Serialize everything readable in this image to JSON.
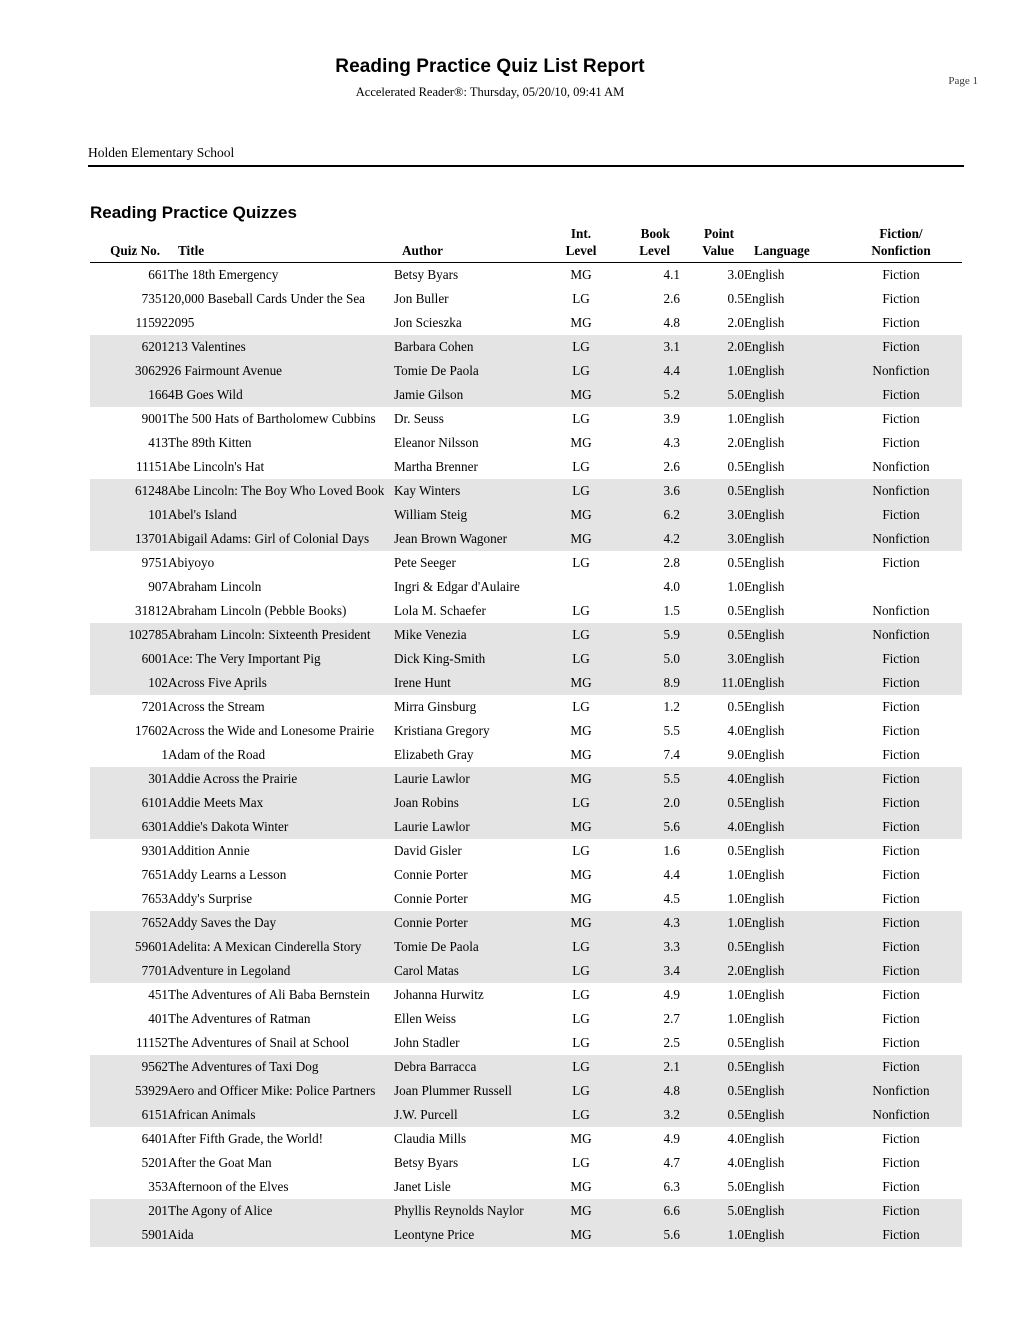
{
  "header": {
    "title": "Reading Practice Quiz List Report",
    "subtitle": "Accelerated Reader®:  Thursday, 05/20/10, 09:41 AM",
    "page_label": "Page 1"
  },
  "school": {
    "name": "Holden Elementary School"
  },
  "section": {
    "title": "Reading Practice Quizzes"
  },
  "columns": {
    "quiz_no": "Quiz No.",
    "title": "Title",
    "author": "Author",
    "int_level_l1": "Int.",
    "int_level_l2": "Level",
    "book_level_l1": "Book",
    "book_level_l2": "Level",
    "point_value_l1": "Point",
    "point_value_l2": "Value",
    "language": "Language",
    "fiction_l1": "Fiction/",
    "fiction_l2": "Nonfiction"
  },
  "rows": [
    {
      "quiz_no": "661",
      "title": "The 18th Emergency",
      "author": "Betsy Byars",
      "int_level": "MG",
      "book_level": "4.1",
      "point_value": "3.0",
      "language": "English",
      "fiction": "Fiction"
    },
    {
      "quiz_no": "7351",
      "title": "20,000 Baseball Cards Under the Sea",
      "author": "Jon Buller",
      "int_level": "LG",
      "book_level": "2.6",
      "point_value": "0.5",
      "language": "English",
      "fiction": "Fiction"
    },
    {
      "quiz_no": "11592",
      "title": "2095",
      "author": "Jon Scieszka",
      "int_level": "MG",
      "book_level": "4.8",
      "point_value": "2.0",
      "language": "English",
      "fiction": "Fiction"
    },
    {
      "quiz_no": "6201",
      "title": "213 Valentines",
      "author": "Barbara Cohen",
      "int_level": "LG",
      "book_level": "3.1",
      "point_value": "2.0",
      "language": "English",
      "fiction": "Fiction"
    },
    {
      "quiz_no": "30629",
      "title": "26 Fairmount Avenue",
      "author": "Tomie De Paola",
      "int_level": "LG",
      "book_level": "4.4",
      "point_value": "1.0",
      "language": "English",
      "fiction": "Nonfiction"
    },
    {
      "quiz_no": "166",
      "title": "4B Goes Wild",
      "author": "Jamie Gilson",
      "int_level": "MG",
      "book_level": "5.2",
      "point_value": "5.0",
      "language": "English",
      "fiction": "Fiction"
    },
    {
      "quiz_no": "9001",
      "title": "The 500 Hats of Bartholomew Cubbins",
      "author": "Dr. Seuss",
      "int_level": "LG",
      "book_level": "3.9",
      "point_value": "1.0",
      "language": "English",
      "fiction": "Fiction"
    },
    {
      "quiz_no": "413",
      "title": "The 89th Kitten",
      "author": "Eleanor Nilsson",
      "int_level": "MG",
      "book_level": "4.3",
      "point_value": "2.0",
      "language": "English",
      "fiction": "Fiction"
    },
    {
      "quiz_no": "11151",
      "title": "Abe Lincoln's Hat",
      "author": "Martha Brenner",
      "int_level": "LG",
      "book_level": "2.6",
      "point_value": "0.5",
      "language": "English",
      "fiction": "Nonfiction"
    },
    {
      "quiz_no": "61248",
      "title": "Abe Lincoln: The Boy Who Loved Books",
      "author": "Kay Winters",
      "int_level": "LG",
      "book_level": "3.6",
      "point_value": "0.5",
      "language": "English",
      "fiction": "Nonfiction"
    },
    {
      "quiz_no": "101",
      "title": "Abel's Island",
      "author": "William Steig",
      "int_level": "MG",
      "book_level": "6.2",
      "point_value": "3.0",
      "language": "English",
      "fiction": "Fiction"
    },
    {
      "quiz_no": "13701",
      "title": "Abigail Adams: Girl of Colonial Days",
      "author": "Jean Brown Wagoner",
      "int_level": "MG",
      "book_level": "4.2",
      "point_value": "3.0",
      "language": "English",
      "fiction": "Nonfiction"
    },
    {
      "quiz_no": "9751",
      "title": "Abiyoyo",
      "author": "Pete Seeger",
      "int_level": "LG",
      "book_level": "2.8",
      "point_value": "0.5",
      "language": "English",
      "fiction": "Fiction"
    },
    {
      "quiz_no": "907",
      "title": "Abraham Lincoln",
      "author": "Ingri & Edgar d'Aulaire",
      "int_level": "",
      "book_level": "4.0",
      "point_value": "1.0",
      "language": "English",
      "fiction": ""
    },
    {
      "quiz_no": "31812",
      "title": "Abraham Lincoln (Pebble Books)",
      "author": "Lola M. Schaefer",
      "int_level": "LG",
      "book_level": "1.5",
      "point_value": "0.5",
      "language": "English",
      "fiction": "Nonfiction"
    },
    {
      "quiz_no": "102785",
      "title": "Abraham Lincoln: Sixteenth President",
      "author": "Mike Venezia",
      "int_level": "LG",
      "book_level": "5.9",
      "point_value": "0.5",
      "language": "English",
      "fiction": "Nonfiction"
    },
    {
      "quiz_no": "6001",
      "title": "Ace: The Very Important Pig",
      "author": "Dick King-Smith",
      "int_level": "LG",
      "book_level": "5.0",
      "point_value": "3.0",
      "language": "English",
      "fiction": "Fiction"
    },
    {
      "quiz_no": "102",
      "title": "Across Five Aprils",
      "author": "Irene Hunt",
      "int_level": "MG",
      "book_level": "8.9",
      "point_value": "11.0",
      "language": "English",
      "fiction": "Fiction"
    },
    {
      "quiz_no": "7201",
      "title": "Across the Stream",
      "author": "Mirra Ginsburg",
      "int_level": "LG",
      "book_level": "1.2",
      "point_value": "0.5",
      "language": "English",
      "fiction": "Fiction"
    },
    {
      "quiz_no": "17602",
      "title": "Across the Wide and Lonesome Prairie",
      "author": "Kristiana Gregory",
      "int_level": "MG",
      "book_level": "5.5",
      "point_value": "4.0",
      "language": "English",
      "fiction": "Fiction"
    },
    {
      "quiz_no": "1",
      "title": "Adam of the Road",
      "author": "Elizabeth Gray",
      "int_level": "MG",
      "book_level": "7.4",
      "point_value": "9.0",
      "language": "English",
      "fiction": "Fiction"
    },
    {
      "quiz_no": "301",
      "title": "Addie Across the Prairie",
      "author": "Laurie Lawlor",
      "int_level": "MG",
      "book_level": "5.5",
      "point_value": "4.0",
      "language": "English",
      "fiction": "Fiction"
    },
    {
      "quiz_no": "6101",
      "title": "Addie Meets Max",
      "author": "Joan Robins",
      "int_level": "LG",
      "book_level": "2.0",
      "point_value": "0.5",
      "language": "English",
      "fiction": "Fiction"
    },
    {
      "quiz_no": "6301",
      "title": "Addie's Dakota Winter",
      "author": "Laurie Lawlor",
      "int_level": "MG",
      "book_level": "5.6",
      "point_value": "4.0",
      "language": "English",
      "fiction": "Fiction"
    },
    {
      "quiz_no": "9301",
      "title": "Addition Annie",
      "author": "David Gisler",
      "int_level": "LG",
      "book_level": "1.6",
      "point_value": "0.5",
      "language": "English",
      "fiction": "Fiction"
    },
    {
      "quiz_no": "7651",
      "title": "Addy Learns a Lesson",
      "author": "Connie Porter",
      "int_level": "MG",
      "book_level": "4.4",
      "point_value": "1.0",
      "language": "English",
      "fiction": "Fiction"
    },
    {
      "quiz_no": "7653",
      "title": "Addy's Surprise",
      "author": "Connie Porter",
      "int_level": "MG",
      "book_level": "4.5",
      "point_value": "1.0",
      "language": "English",
      "fiction": "Fiction"
    },
    {
      "quiz_no": "7652",
      "title": "Addy Saves the Day",
      "author": "Connie Porter",
      "int_level": "MG",
      "book_level": "4.3",
      "point_value": "1.0",
      "language": "English",
      "fiction": "Fiction"
    },
    {
      "quiz_no": "59601",
      "title": "Adelita: A Mexican Cinderella Story",
      "author": "Tomie De Paola",
      "int_level": "LG",
      "book_level": "3.3",
      "point_value": "0.5",
      "language": "English",
      "fiction": "Fiction"
    },
    {
      "quiz_no": "7701",
      "title": "Adventure in Legoland",
      "author": "Carol Matas",
      "int_level": "LG",
      "book_level": "3.4",
      "point_value": "2.0",
      "language": "English",
      "fiction": "Fiction"
    },
    {
      "quiz_no": "451",
      "title": "The Adventures of Ali Baba Bernstein",
      "author": "Johanna Hurwitz",
      "int_level": "LG",
      "book_level": "4.9",
      "point_value": "1.0",
      "language": "English",
      "fiction": "Fiction"
    },
    {
      "quiz_no": "401",
      "title": "The Adventures of Ratman",
      "author": "Ellen Weiss",
      "int_level": "LG",
      "book_level": "2.7",
      "point_value": "1.0",
      "language": "English",
      "fiction": "Fiction"
    },
    {
      "quiz_no": "11152",
      "title": "The Adventures of Snail at School",
      "author": "John Stadler",
      "int_level": "LG",
      "book_level": "2.5",
      "point_value": "0.5",
      "language": "English",
      "fiction": "Fiction"
    },
    {
      "quiz_no": "9562",
      "title": "The Adventures of Taxi Dog",
      "author": "Debra Barracca",
      "int_level": "LG",
      "book_level": "2.1",
      "point_value": "0.5",
      "language": "English",
      "fiction": "Fiction"
    },
    {
      "quiz_no": "53929",
      "title": "Aero and Officer Mike: Police Partners",
      "author": "Joan Plummer Russell",
      "int_level": "LG",
      "book_level": "4.8",
      "point_value": "0.5",
      "language": "English",
      "fiction": "Nonfiction"
    },
    {
      "quiz_no": "6151",
      "title": "African Animals",
      "author": "J.W. Purcell",
      "int_level": "LG",
      "book_level": "3.2",
      "point_value": "0.5",
      "language": "English",
      "fiction": "Nonfiction"
    },
    {
      "quiz_no": "6401",
      "title": "After Fifth Grade, the World!",
      "author": "Claudia Mills",
      "int_level": "MG",
      "book_level": "4.9",
      "point_value": "4.0",
      "language": "English",
      "fiction": "Fiction"
    },
    {
      "quiz_no": "5201",
      "title": "After the Goat Man",
      "author": "Betsy Byars",
      "int_level": "LG",
      "book_level": "4.7",
      "point_value": "4.0",
      "language": "English",
      "fiction": "Fiction"
    },
    {
      "quiz_no": "353",
      "title": "Afternoon of the Elves",
      "author": "Janet Lisle",
      "int_level": "MG",
      "book_level": "6.3",
      "point_value": "5.0",
      "language": "English",
      "fiction": "Fiction"
    },
    {
      "quiz_no": "201",
      "title": "The Agony of Alice",
      "author": "Phyllis Reynolds Naylor",
      "int_level": "MG",
      "book_level": "6.6",
      "point_value": "5.0",
      "language": "English",
      "fiction": "Fiction"
    },
    {
      "quiz_no": "5901",
      "title": "Aida",
      "author": "Leontyne Price",
      "int_level": "MG",
      "book_level": "5.6",
      "point_value": "1.0",
      "language": "English",
      "fiction": "Fiction"
    }
  ],
  "style": {
    "shade_color": "#e4e4e4",
    "text_color": "#000000"
  }
}
